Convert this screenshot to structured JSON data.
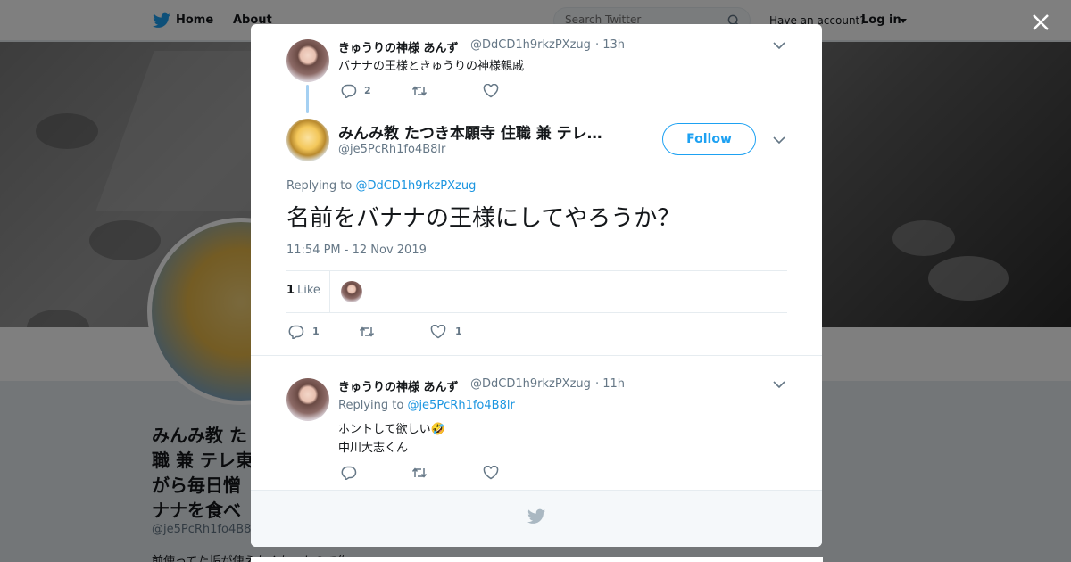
{
  "topbar": {
    "home_label": "Home",
    "about_label": "About",
    "search_placeholder": "Search Twitter",
    "have_account": "Have an account?",
    "login_label": "Log in"
  },
  "background_profile": {
    "name_lines": [
      "みんみ教 た",
      "職 兼 テレ東",
      "がら毎日憎",
      "ナナを食べ"
    ],
    "handle": "@je5PcRh1fo4B8",
    "bio_fragment": "前使ってた垢が使えなくなったので作"
  },
  "modal": {
    "parent_tweet": {
      "name": "きゅうりの神様 あんず",
      "handle": "@DdCD1h9rkzPXzug",
      "time": "· 13h",
      "text": "バナナの王様ときゅうりの神様親戚",
      "reply_count": "2"
    },
    "main_tweet": {
      "name": "みんみ教 たつき本願寺 住職 兼 テレ…",
      "handle": "@je5PcRh1fo4B8lr",
      "follow_label": "Follow",
      "replying_prefix": "Replying to ",
      "replying_to": "@DdCD1h9rkzPXzug",
      "text": "名前をバナナの王様にしてやろうか？",
      "timestamp": "11:54 PM - 12 Nov 2019",
      "likes_count": "1",
      "likes_label": "Like",
      "reply_count": "1",
      "like_count": "1"
    },
    "reply_tweet": {
      "name": "きゅうりの神様 あんず",
      "handle": "@DdCD1h9rkzPXzug",
      "time": "· 11h",
      "replying_prefix": "Replying to ",
      "replying_to": "@je5PcRh1fo4B8lr",
      "text_line1": "ホントして欲しい🤣",
      "text_line2": "中川大志くん"
    }
  },
  "colors": {
    "accent": "#1da1f2",
    "link": "#1b95e0",
    "muted": "#657786",
    "thread_line": "#a5d0f2"
  },
  "icons": [
    "twitter-bird-icon",
    "search-icon",
    "close-icon",
    "reply-icon",
    "retweet-icon",
    "like-icon",
    "chevron-down-icon"
  ]
}
